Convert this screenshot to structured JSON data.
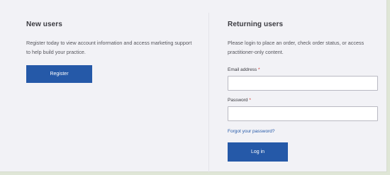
{
  "new_users": {
    "heading": "New users",
    "description": "Register today to view account information and access marketing support to help build your practice.",
    "register_label": "Register"
  },
  "returning_users": {
    "heading": "Returning users",
    "description": "Please login to place an order, check order status, or access practitioner-only content.",
    "email_label": "Email address",
    "email_value": "",
    "password_label": "Password",
    "password_value": "",
    "required_marker": "*",
    "forgot_label": "Forgot your password?",
    "login_label": "Log in"
  },
  "colors": {
    "accent": "#2559a8",
    "required": "#d0342c",
    "panel_background": "#f2f2f6"
  }
}
